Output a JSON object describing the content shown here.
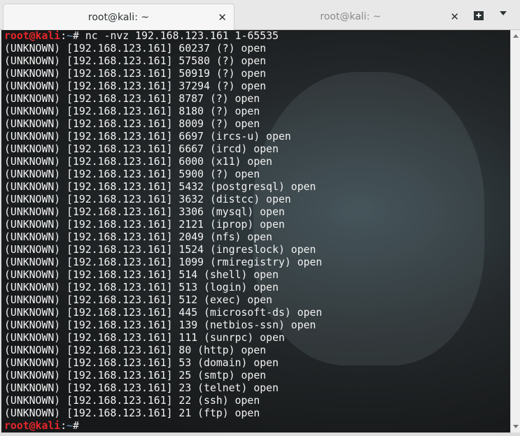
{
  "tabs": [
    {
      "title": "root@kali: ~",
      "active": true
    },
    {
      "title": "root@kali: ~",
      "active": false
    }
  ],
  "prompt": {
    "user_host": "root@kali",
    "sep": ":",
    "path": "~",
    "symbol": "#"
  },
  "command": " nc -nvz 192.168.123.161 1-65535",
  "output": [
    "(UNKNOWN) [192.168.123.161] 60237 (?) open",
    "(UNKNOWN) [192.168.123.161] 57580 (?) open",
    "(UNKNOWN) [192.168.123.161] 50919 (?) open",
    "(UNKNOWN) [192.168.123.161] 37294 (?) open",
    "(UNKNOWN) [192.168.123.161] 8787 (?) open",
    "(UNKNOWN) [192.168.123.161] 8180 (?) open",
    "(UNKNOWN) [192.168.123.161] 8009 (?) open",
    "(UNKNOWN) [192.168.123.161] 6697 (ircs-u) open",
    "(UNKNOWN) [192.168.123.161] 6667 (ircd) open",
    "(UNKNOWN) [192.168.123.161] 6000 (x11) open",
    "(UNKNOWN) [192.168.123.161] 5900 (?) open",
    "(UNKNOWN) [192.168.123.161] 5432 (postgresql) open",
    "(UNKNOWN) [192.168.123.161] 3632 (distcc) open",
    "(UNKNOWN) [192.168.123.161] 3306 (mysql) open",
    "(UNKNOWN) [192.168.123.161] 2121 (iprop) open",
    "(UNKNOWN) [192.168.123.161] 2049 (nfs) open",
    "(UNKNOWN) [192.168.123.161] 1524 (ingreslock) open",
    "(UNKNOWN) [192.168.123.161] 1099 (rmiregistry) open",
    "(UNKNOWN) [192.168.123.161] 514 (shell) open",
    "(UNKNOWN) [192.168.123.161] 513 (login) open",
    "(UNKNOWN) [192.168.123.161] 512 (exec) open",
    "(UNKNOWN) [192.168.123.161] 445 (microsoft-ds) open",
    "(UNKNOWN) [192.168.123.161] 139 (netbios-ssn) open",
    "(UNKNOWN) [192.168.123.161] 111 (sunrpc) open",
    "(UNKNOWN) [192.168.123.161] 80 (http) open",
    "(UNKNOWN) [192.168.123.161] 53 (domain) open",
    "(UNKNOWN) [192.168.123.161] 25 (smtp) open",
    "(UNKNOWN) [192.168.123.161] 23 (telnet) open",
    "(UNKNOWN) [192.168.123.161] 22 (ssh) open",
    "(UNKNOWN) [192.168.123.161] 21 (ftp) open"
  ],
  "colors": {
    "prompt_user": "#e8262a",
    "prompt_path": "#6f9fd8",
    "text": "#f2f2f2"
  }
}
